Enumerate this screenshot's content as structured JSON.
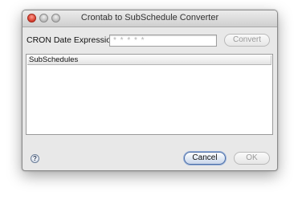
{
  "window": {
    "title": "Crontab to SubSchedule Converter"
  },
  "cron": {
    "label": "CRON Date Expression:",
    "value": "* * * * *"
  },
  "buttons": {
    "convert": "Convert",
    "cancel": "Cancel",
    "ok": "OK"
  },
  "table": {
    "header": "SubSchedules",
    "rows": []
  },
  "help": {
    "glyph": "?"
  },
  "colors": {
    "default_button_border": "#4d6fa8",
    "close_button": "#d43a2a"
  }
}
